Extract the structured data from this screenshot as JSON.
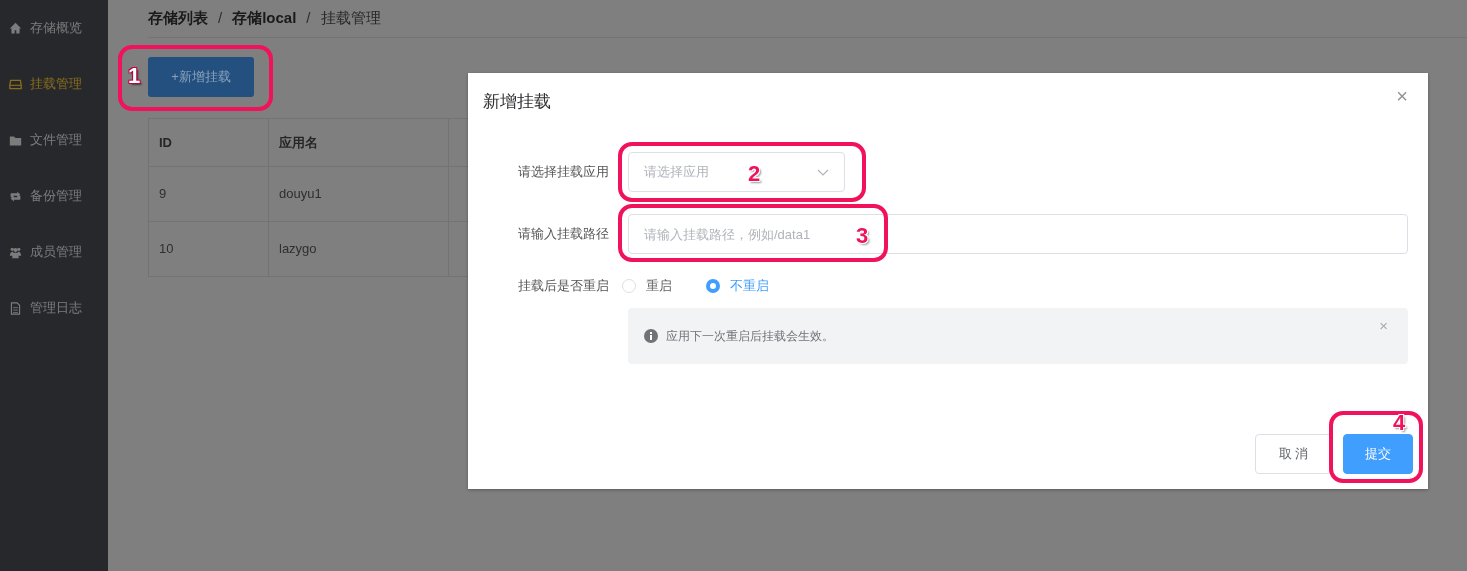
{
  "sidebar": {
    "items": [
      {
        "label": "存储概览",
        "selected": false
      },
      {
        "label": "挂载管理",
        "selected": true
      },
      {
        "label": "文件管理",
        "selected": false
      },
      {
        "label": "备份管理",
        "selected": false
      },
      {
        "label": "成员管理",
        "selected": false
      },
      {
        "label": "管理日志",
        "selected": false
      }
    ]
  },
  "breadcrumb": [
    {
      "label": "存储列表",
      "current": false
    },
    {
      "separator": "/",
      "label": "存储local",
      "current": false
    },
    {
      "separator": "/",
      "label": "挂载管理",
      "current": true
    }
  ],
  "add_button": "+新增挂载",
  "table": {
    "columns": [
      "ID",
      "应用名"
    ],
    "rows": [
      [
        "9",
        "douyu1"
      ],
      [
        "10",
        "lazygo"
      ]
    ]
  },
  "dialog": {
    "title": "新增挂载",
    "close": "×",
    "fields": [
      {
        "kind": "select",
        "label": "请选择挂载应用",
        "placeholder": "请选择应用"
      },
      {
        "kind": "input",
        "label": "请输入挂载路径",
        "placeholder": "请输入挂载路径，例如/data1"
      }
    ],
    "restart": {
      "label": "挂载后是否重启",
      "options": [
        {
          "label": "重启",
          "selected": false
        },
        {
          "label": "不重启",
          "selected": true
        }
      ]
    },
    "alert": {
      "text": "应用下一次重启后挂载会生效。",
      "close": "×"
    },
    "buttons": [
      {
        "label": "取 消",
        "kind": "default"
      },
      {
        "label": "提交",
        "kind": "primary"
      }
    ]
  },
  "annotations": [
    {
      "number": "1"
    },
    {
      "number": "2"
    },
    {
      "number": "3"
    },
    {
      "number": "4"
    }
  ]
}
